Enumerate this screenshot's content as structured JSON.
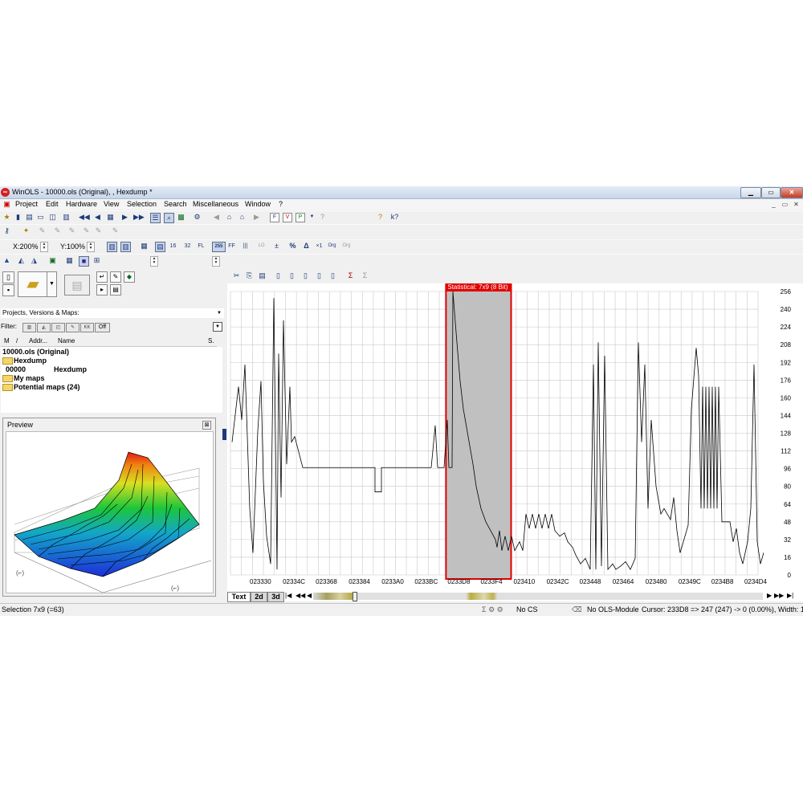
{
  "window": {
    "title": "WinOLS - 10000.ols (Original), , Hexdump *",
    "app_icon": "winols-app-icon",
    "caption_buttons": {
      "minimize": "▁",
      "restore": "▭",
      "close": "✕"
    }
  },
  "menu": {
    "items": [
      "Project",
      "Edit",
      "Hardware",
      "View",
      "Selection",
      "Search",
      "Miscellaneous",
      "Window",
      "?"
    ],
    "mdi_buttons": {
      "minimize": "_",
      "restore": "▭",
      "close": "✕"
    }
  },
  "toolbar": {
    "zoom_x": "X:200%",
    "zoom_y": "Y:100%",
    "value_format_label": "255"
  },
  "left_panel": {
    "projects_dropdown": "Projects, Versions & Maps:",
    "filter_label": "Filter:",
    "filter_off_label": "Off",
    "columns": [
      "M",
      "/",
      "Addr...",
      "Name",
      "S."
    ],
    "tree": [
      {
        "label": "10000.ols (Original)",
        "type": "project"
      },
      {
        "label": "Hexdump",
        "type": "folder"
      },
      {
        "label": "00000",
        "name": "Hexdump",
        "type": "map"
      },
      {
        "label": "My maps",
        "type": "folder"
      },
      {
        "label": "Potential maps (24)",
        "type": "folder"
      }
    ],
    "preview": {
      "title": "Preview",
      "close": "⊠",
      "axis_marks": [
        "(⌐)",
        "(⌐)"
      ]
    }
  },
  "chart_data": {
    "type": "line",
    "selection_label": "Statistical: 7x9 (8 Bit)",
    "selection_range": [
      "0233D8",
      "023410"
    ],
    "y_ticks": [
      0,
      16,
      32,
      48,
      64,
      80,
      96,
      112,
      128,
      144,
      160,
      176,
      192,
      208,
      224,
      240,
      256
    ],
    "ylim": [
      0,
      256
    ],
    "x_ticks": [
      "023330",
      "02334C",
      "023368",
      "023384",
      "0233A0",
      "0233BC",
      "0233D8",
      "0233F4",
      "023410",
      "02342C",
      "023448",
      "023464",
      "023480",
      "02349C",
      "0234B8",
      "0234D4"
    ],
    "grid": true
  },
  "bottom_tabs": [
    "Text",
    "2d",
    "3d"
  ],
  "status_bar": {
    "left": "Selection 7x9 (=63)",
    "cs": "No CS",
    "module": "No OLS-Module",
    "cursor": "Cursor: 233D8 => 247 (247) -> 0 (0.00%), Width: 1"
  },
  "colors": {
    "selection_border": "#e00000",
    "selection_fill": "#c0c0c0",
    "grid": "#c8c8c8",
    "curve": "#000000"
  }
}
